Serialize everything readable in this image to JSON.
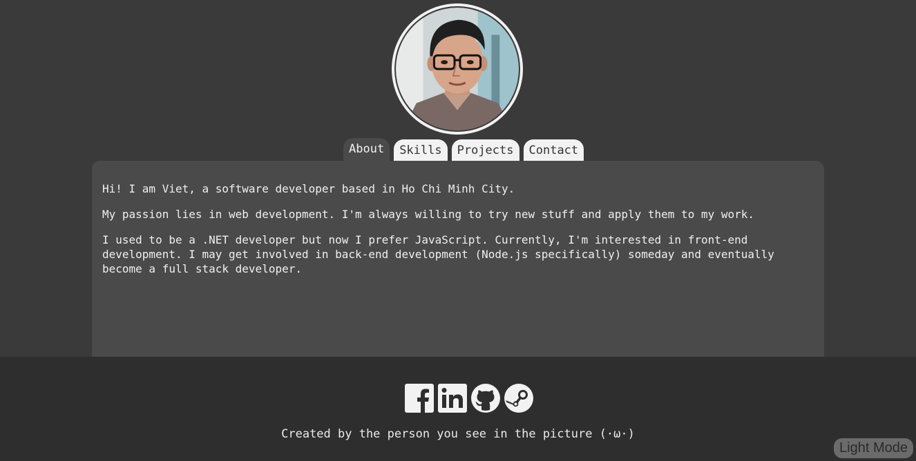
{
  "profile": {
    "avatar_icon": "profile-photo"
  },
  "tabs": [
    {
      "label": "About",
      "active": true
    },
    {
      "label": "Skills",
      "active": false
    },
    {
      "label": "Projects",
      "active": false
    },
    {
      "label": "Contact",
      "active": false
    }
  ],
  "about": {
    "paragraphs": [
      "Hi! I am Viet, a software developer based in Ho Chi Minh City.",
      "My passion lies in web development. I'm always willing to try new stuff and apply them to my work.",
      "I used to be a .NET developer but now I prefer JavaScript. Currently, I'm interested in front-end development. I may get involved in back-end development (Node.js specifically) someday and eventually become a full stack developer."
    ]
  },
  "footer": {
    "social_icons": [
      "facebook-icon",
      "linkedin-icon",
      "github-icon",
      "steam-icon"
    ],
    "credit": "Created by the person you see in the picture (·ω·)"
  },
  "mode_toggle": {
    "label": "Light Mode"
  },
  "colors": {
    "background": "#3a3a3a",
    "panel": "#4a4a4a",
    "footer": "#2e2e2e",
    "tab_inactive": "#f2f2f2"
  }
}
